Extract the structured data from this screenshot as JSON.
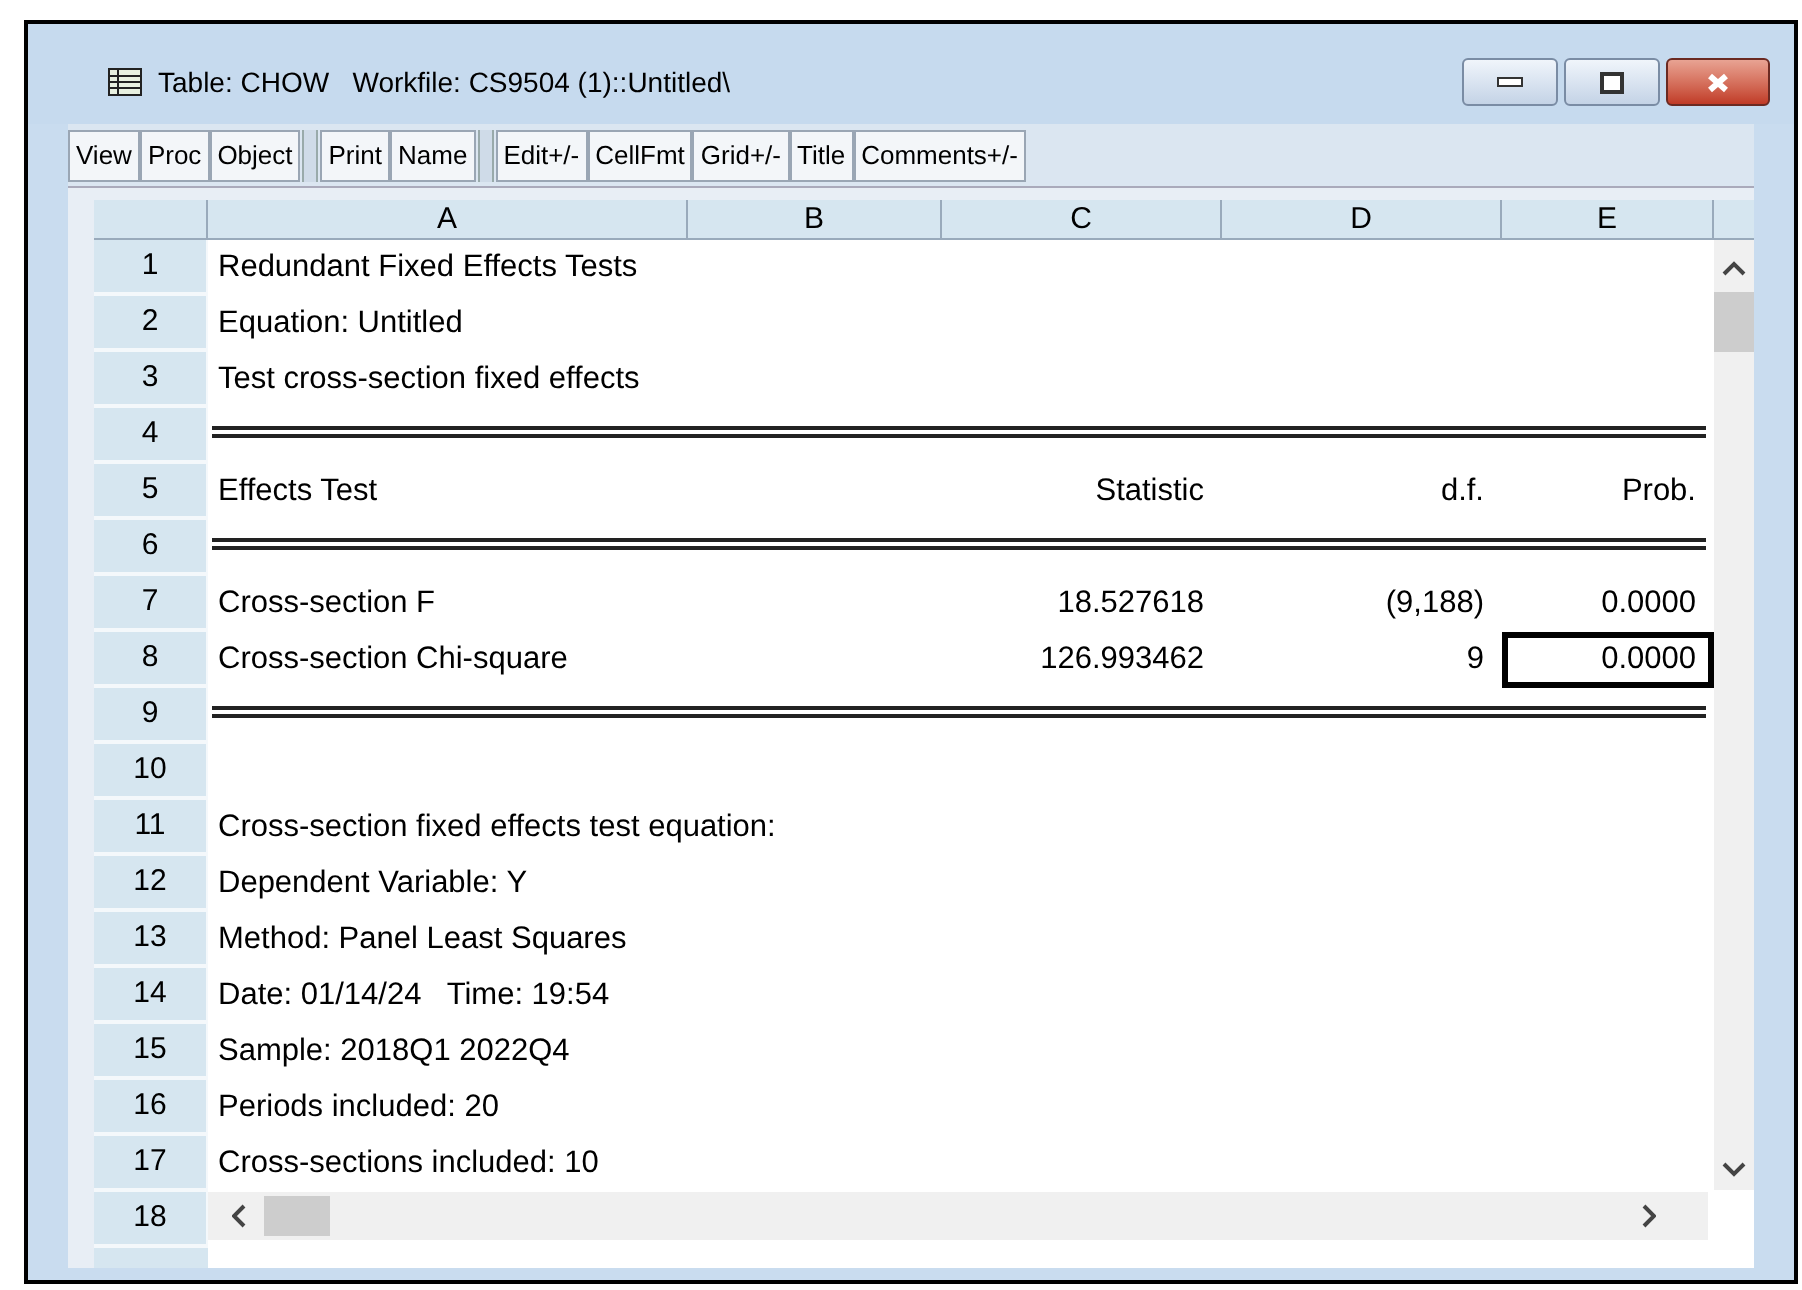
{
  "window": {
    "title": "Table: CHOW   Workfile: CS9504 (1)::Untitled\\"
  },
  "toolbar": [
    {
      "label": "View",
      "group_start": false
    },
    {
      "label": "Proc",
      "group_start": false
    },
    {
      "label": "Object",
      "group_start": false
    },
    {
      "label": "Print",
      "group_start": true
    },
    {
      "label": "Name",
      "group_start": false
    },
    {
      "label": "Edit+/-",
      "group_start": true
    },
    {
      "label": "CellFmt",
      "group_start": false
    },
    {
      "label": "Grid+/-",
      "group_start": false
    },
    {
      "label": "Title",
      "group_start": false
    },
    {
      "label": "Comments+/-",
      "group_start": false
    }
  ],
  "columns": [
    "A",
    "B",
    "C",
    "D",
    "E"
  ],
  "rows": [
    {
      "number": "1",
      "rule": false,
      "cells": {
        "A": {
          "text": "Redundant Fixed Effects Tests",
          "selected": false
        }
      }
    },
    {
      "number": "2",
      "rule": false,
      "cells": {
        "A": {
          "text": "Equation: Untitled",
          "selected": false
        }
      }
    },
    {
      "number": "3",
      "rule": false,
      "cells": {
        "A": {
          "text": "Test cross-section fixed effects",
          "selected": false
        }
      }
    },
    {
      "number": "4",
      "rule": true,
      "cells": {}
    },
    {
      "number": "5",
      "rule": false,
      "cells": {
        "A": {
          "text": "Effects Test",
          "selected": false
        },
        "C": {
          "text": "Statistic",
          "selected": false
        },
        "D": {
          "text": "d.f.",
          "selected": false
        },
        "E": {
          "text": "Prob.",
          "selected": false
        }
      }
    },
    {
      "number": "6",
      "rule": true,
      "cells": {}
    },
    {
      "number": "7",
      "rule": false,
      "cells": {
        "A": {
          "text": "Cross-section F",
          "selected": false
        },
        "C": {
          "text": "18.527618",
          "selected": false
        },
        "D": {
          "text": "(9,188)",
          "selected": false
        },
        "E": {
          "text": "0.0000",
          "selected": false
        }
      }
    },
    {
      "number": "8",
      "rule": false,
      "cells": {
        "A": {
          "text": "Cross-section Chi-square",
          "selected": false
        },
        "C": {
          "text": "126.993462",
          "selected": false
        },
        "D": {
          "text": "9",
          "selected": false
        },
        "E": {
          "text": "0.0000",
          "selected": true
        }
      }
    },
    {
      "number": "9",
      "rule": true,
      "cells": {}
    },
    {
      "number": "10",
      "rule": false,
      "cells": {}
    },
    {
      "number": "11",
      "rule": false,
      "cells": {
        "A": {
          "text": "Cross-section fixed effects test equation:",
          "selected": false
        }
      }
    },
    {
      "number": "12",
      "rule": false,
      "cells": {
        "A": {
          "text": "Dependent Variable: Y",
          "selected": false
        }
      }
    },
    {
      "number": "13",
      "rule": false,
      "cells": {
        "A": {
          "text": "Method: Panel Least Squares",
          "selected": false
        }
      }
    },
    {
      "number": "14",
      "rule": false,
      "cells": {
        "A": {
          "text": "Date: 01/14/24   Time: 19:54",
          "selected": false
        }
      }
    },
    {
      "number": "15",
      "rule": false,
      "cells": {
        "A": {
          "text": "Sample: 2018Q1 2022Q4",
          "selected": false
        }
      }
    },
    {
      "number": "16",
      "rule": false,
      "cells": {
        "A": {
          "text": "Periods included: 20",
          "selected": false
        }
      }
    },
    {
      "number": "17",
      "rule": false,
      "cells": {
        "A": {
          "text": "Cross-sections included: 10",
          "selected": false
        }
      }
    },
    {
      "number": "18",
      "rule": false,
      "cells": {}
    }
  ]
}
